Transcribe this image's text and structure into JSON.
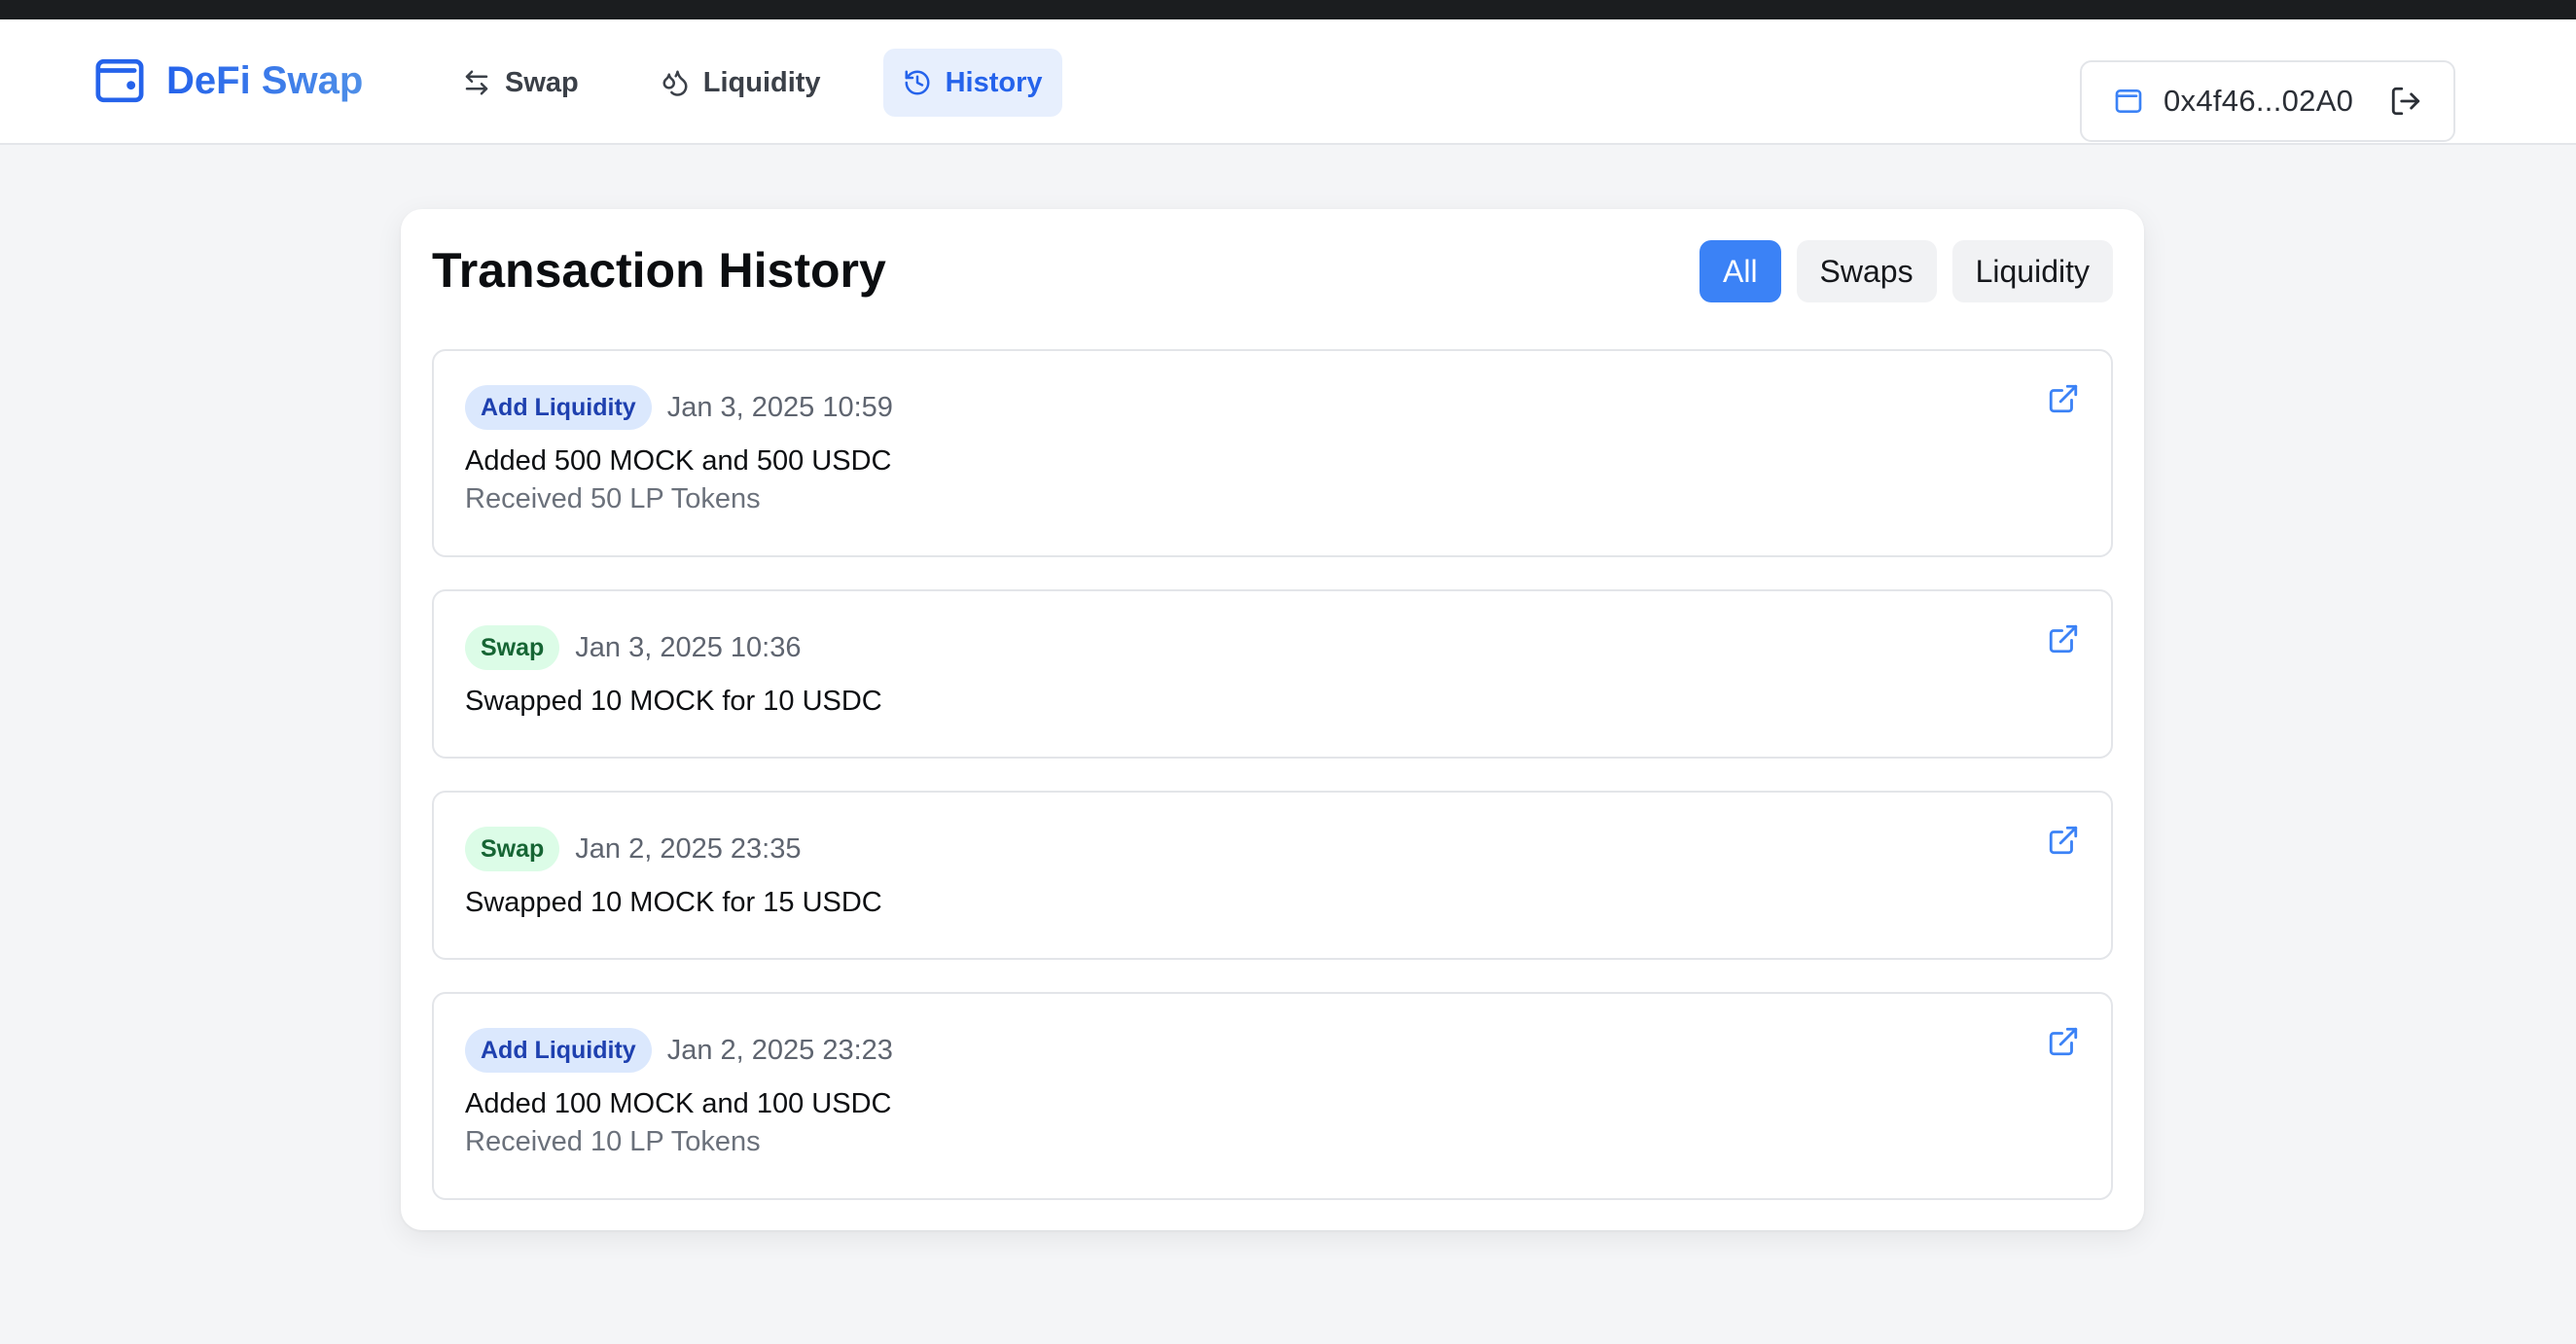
{
  "app": {
    "title": "DeFi Swap",
    "icon": "wallet-icon",
    "accent_color": "#2563eb"
  },
  "nav": [
    {
      "label": "Swap",
      "icon": "arrows-left-right-icon",
      "active": false
    },
    {
      "label": "Liquidity",
      "icon": "droplets-icon",
      "active": false
    },
    {
      "label": "History",
      "icon": "history-icon",
      "active": true
    }
  ],
  "wallet": {
    "address": "0x4f46...02A0",
    "icon": "wallet-icon",
    "logout_icon": "logout-icon"
  },
  "history": {
    "title": "Transaction History",
    "filters": [
      {
        "label": "All",
        "active": true
      },
      {
        "label": "Swaps",
        "active": false
      },
      {
        "label": "Liquidity",
        "active": false
      }
    ],
    "transactions": [
      {
        "type": "Add Liquidity",
        "date": "Jan 3, 2025 10:59",
        "description": "Added 500 MOCK and 500 USDC",
        "detail": "Received 50 LP Tokens",
        "badge_color": "#dbe8fd"
      },
      {
        "type": "Swap",
        "date": "Jan 3, 2025 10:36",
        "description": "Swapped 10 MOCK for 10 USDC",
        "badge_color": "#dcfce7"
      },
      {
        "type": "Swap",
        "date": "Jan 2, 2025 23:35",
        "description": "Swapped 10 MOCK for 15 USDC",
        "badge_color": "#dcfce7"
      },
      {
        "type": "Add Liquidity",
        "date": "Jan 2, 2025 23:23",
        "description": "Added 100 MOCK and 100 USDC",
        "detail": "Received 10 LP Tokens",
        "badge_color": "#dbe8fd"
      }
    ]
  }
}
